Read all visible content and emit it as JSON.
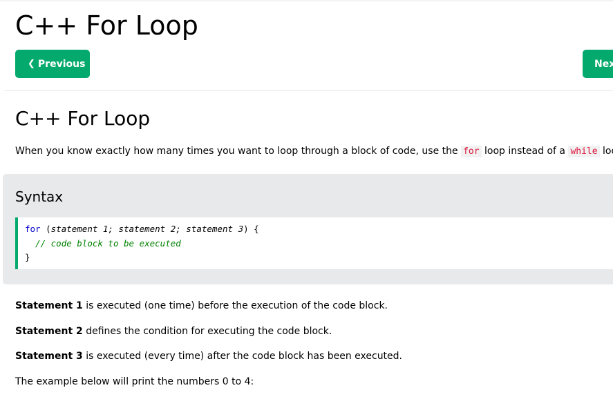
{
  "page": {
    "title": "C++ For Loop",
    "prev_label": "Previous",
    "next_label": "Nex"
  },
  "section": {
    "title": "C++ For Loop",
    "intro_before": "When you know exactly how many times you want to loop through a block of code, use the ",
    "intro_kw1": "for",
    "intro_middle": " loop instead of a ",
    "intro_kw2": "while",
    "intro_after": " loop:"
  },
  "syntax": {
    "title": "Syntax",
    "line1_kw": "for",
    "line1_open": " (",
    "line1_args": "statement 1; statement 2; statement 3",
    "line1_close": ") {",
    "line2_indent": "  ",
    "line2_comment": "// code block to be executed",
    "line3": "}"
  },
  "statements": [
    {
      "bold": "Statement 1",
      "text": " is executed (one time) before the execution of the code block."
    },
    {
      "bold": "Statement 2",
      "text": " defines the condition for executing the code block."
    },
    {
      "bold": "Statement 3",
      "text": " is executed (every time) after the code block has been executed."
    }
  ],
  "example_text": "The example below will print the numbers 0 to 4:",
  "colors": {
    "accent": "#04aa6d",
    "syntax_bg": "#e7e9eb",
    "keyword_inline": "#dc143c",
    "code_keyword": "#0000cd",
    "code_comment": "#008000"
  }
}
